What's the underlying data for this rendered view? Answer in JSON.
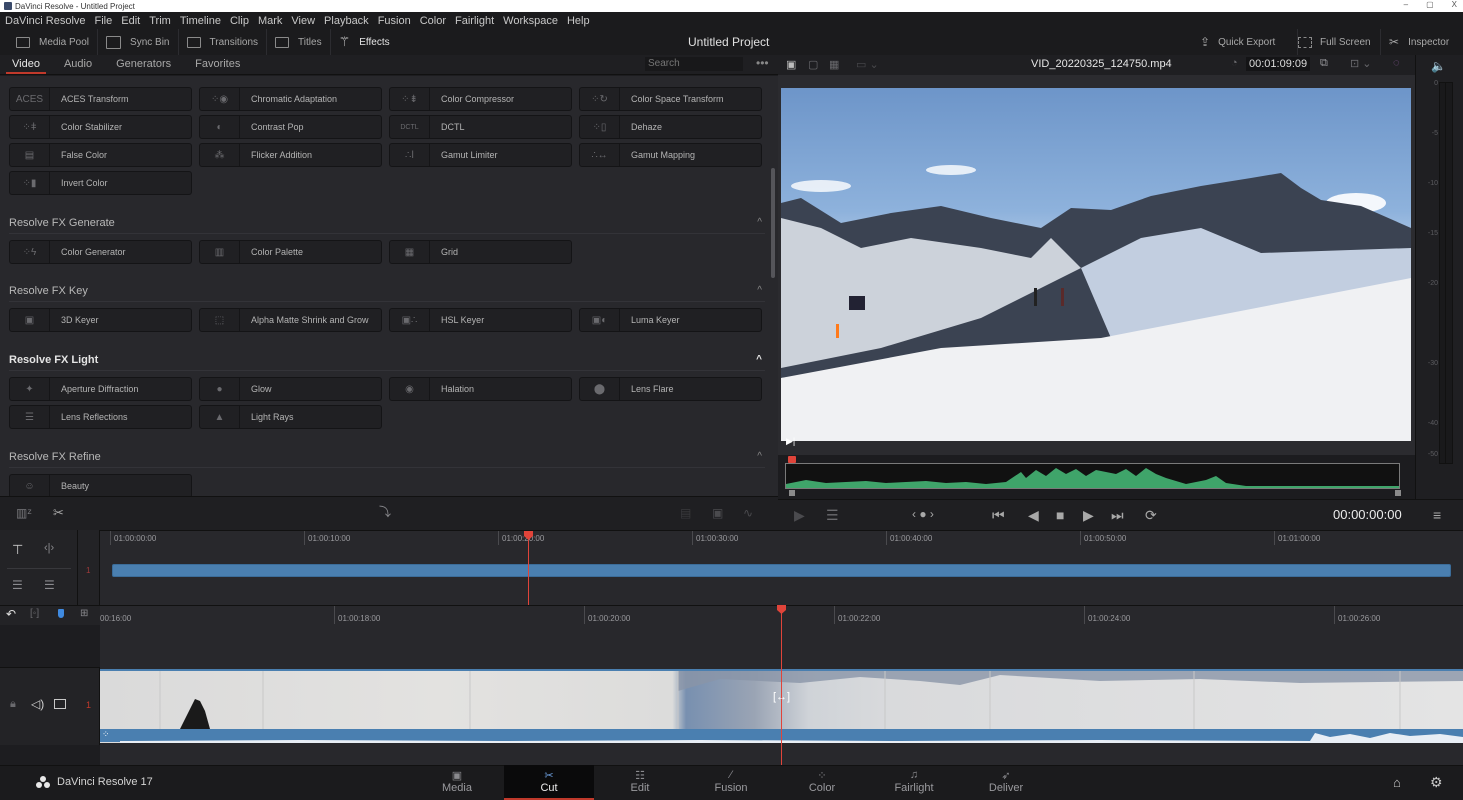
{
  "window": {
    "title": "DaVinci Resolve - Untitled Project",
    "minimize": "–",
    "maximize": "▢",
    "close": "X"
  },
  "menu": [
    "DaVinci Resolve",
    "File",
    "Edit",
    "Trim",
    "Timeline",
    "Clip",
    "Mark",
    "View",
    "Playback",
    "Fusion",
    "Color",
    "Fairlight",
    "Workspace",
    "Help"
  ],
  "toolbar": {
    "media_pool": "Media Pool",
    "sync_bin": "Sync Bin",
    "transitions": "Transitions",
    "titles": "Titles",
    "effects": "Effects",
    "project_title": "Untitled Project",
    "quick_export": "Quick Export",
    "full_screen": "Full Screen",
    "inspector": "Inspector"
  },
  "effects": {
    "tabs": [
      "Video",
      "Audio",
      "Generators",
      "Favorites"
    ],
    "active_tab": "Video",
    "search_placeholder": "Search",
    "more": "•••",
    "top_items": [
      [
        "ACES Transform",
        "Chromatic Adaptation",
        "Color Compressor",
        "Color Space Transform"
      ],
      [
        "Color Stabilizer",
        "Contrast Pop",
        "DCTL",
        "Dehaze"
      ],
      [
        "False Color",
        "Flicker Addition",
        "Gamut Limiter",
        "Gamut Mapping"
      ],
      [
        "Invert Color"
      ]
    ],
    "sections": [
      {
        "title": "Resolve FX Generate",
        "items": [
          "Color Generator",
          "Color Palette",
          "Grid"
        ]
      },
      {
        "title": "Resolve FX Key",
        "items": [
          "3D Keyer",
          "Alpha Matte Shrink and Grow",
          "HSL Keyer",
          "Luma Keyer"
        ]
      },
      {
        "title": "Resolve FX Light",
        "items": [
          "Aperture Diffraction",
          "Glow",
          "Halation",
          "Lens Flare",
          "Lens Reflections",
          "Light Rays"
        ]
      },
      {
        "title": "Resolve FX Refine",
        "items": [
          "Beauty"
        ]
      }
    ],
    "aces_glyph": "ACES",
    "dctl_glyph": "DCTL"
  },
  "viewer": {
    "clip_name": "VID_20220325_124750.mp4",
    "duration": "00:01:09:09",
    "timecode": "00:00:00:00",
    "meter_ticks": [
      "0",
      "-5",
      "-10",
      "-15",
      "-20",
      "-30",
      "-40",
      "-50"
    ]
  },
  "timeline": {
    "upper_ruler": [
      "01:00:00:00",
      "01:00:10:00",
      "01:00:20:00",
      "01:00:30:00",
      "01:00:40:00",
      "01:00:50:00",
      "01:01:00:00"
    ],
    "lower_ruler": [
      "00:16:00",
      "01:00:18:00",
      "01:00:20:00",
      "01:00:22:00",
      "01:00:24:00",
      "01:00:26:00"
    ],
    "track_number": "1"
  },
  "pages": [
    {
      "label": "Media",
      "icon": "▣"
    },
    {
      "label": "Cut",
      "icon": "✂"
    },
    {
      "label": "Edit",
      "icon": "☷"
    },
    {
      "label": "Fusion",
      "icon": "⁄"
    },
    {
      "label": "Color",
      "icon": "⁘"
    },
    {
      "label": "Fairlight",
      "icon": "♫"
    },
    {
      "label": "Deliver",
      "icon": "➶"
    }
  ],
  "active_page": "Cut",
  "brand": "DaVinci Resolve 17",
  "colors": {
    "accent_red": "#c0392b",
    "playhead": "#e0443a",
    "clip_blue": "#4a7fb0",
    "waveform_green": "#3fa46a"
  }
}
